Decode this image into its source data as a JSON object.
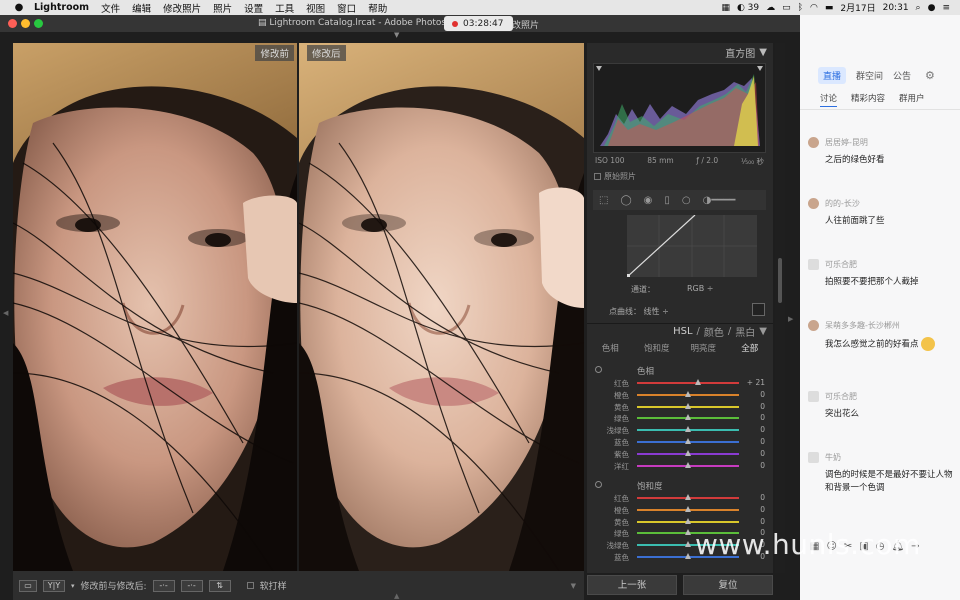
{
  "menubar": {
    "app": "Lightroom",
    "menus": [
      "文件",
      "编辑",
      "修改照片",
      "照片",
      "设置",
      "工具",
      "视图",
      "窗口",
      "帮助"
    ],
    "status": {
      "badge": "39",
      "date": "2月17日",
      "time": "20:31"
    }
  },
  "window": {
    "title": "Lightroom Catalog.lrcat - Adobe Photoshop",
    "title_tail": "改照片",
    "recording_time": "03:28:47"
  },
  "photos": {
    "before_label": "修改前",
    "after_label": "修改后"
  },
  "panel": {
    "histogram_title": "直方图",
    "iso": "ISO 100",
    "focal": "85 mm",
    "aperture": "ƒ / 2.0",
    "shutter": "¹⁄₅₀₀ 秒",
    "original_photo": "原始照片",
    "channel_label": "通道：",
    "channel_value": "RGB ÷",
    "point_curve_label": "点曲线：",
    "point_curve_value": "线性 ÷",
    "hsl_tabs_top": {
      "hsl": "HSL",
      "sep1": "/",
      "color": "颜色",
      "sep2": "/",
      "bw": "黑白"
    },
    "hsl_tabs": [
      "色相",
      "饱和度",
      "明亮度",
      "全部"
    ],
    "hue": {
      "title": "色相",
      "rows": [
        {
          "label": "红色",
          "value": "+ 21",
          "pos": 0.6
        },
        {
          "label": "橙色",
          "value": "0",
          "pos": 0.5
        },
        {
          "label": "黄色",
          "value": "0",
          "pos": 0.5
        },
        {
          "label": "绿色",
          "value": "0",
          "pos": 0.5
        },
        {
          "label": "浅绿色",
          "value": "0",
          "pos": 0.5
        },
        {
          "label": "蓝色",
          "value": "0",
          "pos": 0.5
        },
        {
          "label": "紫色",
          "value": "0",
          "pos": 0.5
        },
        {
          "label": "洋红",
          "value": "0",
          "pos": 0.5
        }
      ]
    },
    "saturation": {
      "title": "饱和度",
      "rows": [
        {
          "label": "红色",
          "value": "0",
          "pos": 0.5
        },
        {
          "label": "橙色",
          "value": "0",
          "pos": 0.5
        },
        {
          "label": "黄色",
          "value": "0",
          "pos": 0.5
        },
        {
          "label": "绿色",
          "value": "0",
          "pos": 0.5
        },
        {
          "label": "浅绿色",
          "value": "0",
          "pos": 0.5
        },
        {
          "label": "蓝色",
          "value": "0",
          "pos": 0.5
        }
      ]
    },
    "prev_button": "上一张",
    "reset_button": "复位"
  },
  "toolbar": {
    "yy": "Y|Y",
    "compare_label": "修改前与修改后:",
    "soft_proof": "软打样"
  },
  "chat": {
    "tabs": [
      "直播",
      "群空间",
      "公告"
    ],
    "subtabs": [
      "讨论",
      "精彩内容",
      "群用户"
    ],
    "messages": [
      {
        "name": "居居婷-昆明",
        "text": "之后的绿色好看"
      },
      {
        "name": "的的-长沙",
        "text": "人往前面跳了些"
      },
      {
        "name": "可乐合肥",
        "text": "拍照要不要把那个人截掉"
      },
      {
        "name": "呆萌多多趣-长沙郴州",
        "text": "我怎么感觉之前的好看点"
      },
      {
        "name": "可乐合肥",
        "text": "突出花么"
      },
      {
        "name": "牛奶",
        "text": "调色的时候是不是最好不要让人物和背景一个色调"
      }
    ]
  },
  "watermark": "www.hunls.com",
  "colors": {
    "hue_tracks": [
      "#d23b3b",
      "#d9822b",
      "#d9c72b",
      "#5bbd3a",
      "#3bbdb0",
      "#3b6fd2",
      "#8a3bd2",
      "#c63bbf"
    ],
    "accent": "#2d6fe0"
  }
}
